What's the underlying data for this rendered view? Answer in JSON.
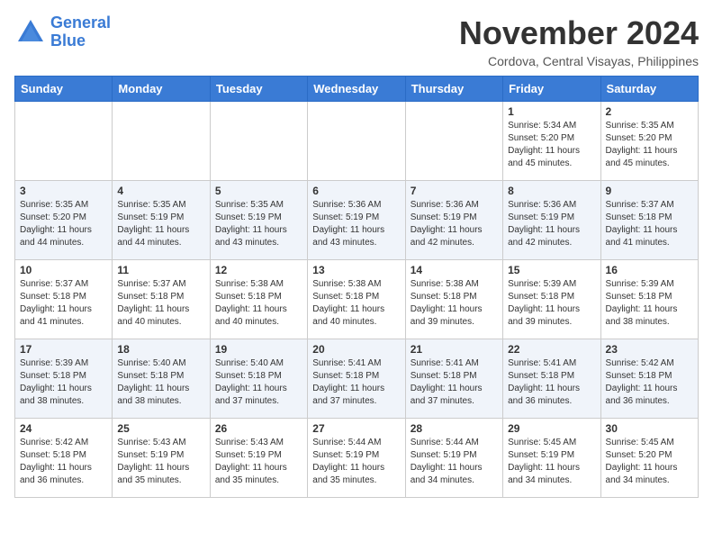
{
  "header": {
    "logo_line1": "General",
    "logo_line2": "Blue",
    "month": "November 2024",
    "location": "Cordova, Central Visayas, Philippines"
  },
  "days_of_week": [
    "Sunday",
    "Monday",
    "Tuesday",
    "Wednesday",
    "Thursday",
    "Friday",
    "Saturday"
  ],
  "weeks": [
    [
      {
        "day": "",
        "sunrise": "",
        "sunset": "",
        "daylight": ""
      },
      {
        "day": "",
        "sunrise": "",
        "sunset": "",
        "daylight": ""
      },
      {
        "day": "",
        "sunrise": "",
        "sunset": "",
        "daylight": ""
      },
      {
        "day": "",
        "sunrise": "",
        "sunset": "",
        "daylight": ""
      },
      {
        "day": "",
        "sunrise": "",
        "sunset": "",
        "daylight": ""
      },
      {
        "day": "1",
        "sunrise": "Sunrise: 5:34 AM",
        "sunset": "Sunset: 5:20 PM",
        "daylight": "Daylight: 11 hours and 45 minutes."
      },
      {
        "day": "2",
        "sunrise": "Sunrise: 5:35 AM",
        "sunset": "Sunset: 5:20 PM",
        "daylight": "Daylight: 11 hours and 45 minutes."
      }
    ],
    [
      {
        "day": "3",
        "sunrise": "Sunrise: 5:35 AM",
        "sunset": "Sunset: 5:20 PM",
        "daylight": "Daylight: 11 hours and 44 minutes."
      },
      {
        "day": "4",
        "sunrise": "Sunrise: 5:35 AM",
        "sunset": "Sunset: 5:19 PM",
        "daylight": "Daylight: 11 hours and 44 minutes."
      },
      {
        "day": "5",
        "sunrise": "Sunrise: 5:35 AM",
        "sunset": "Sunset: 5:19 PM",
        "daylight": "Daylight: 11 hours and 43 minutes."
      },
      {
        "day": "6",
        "sunrise": "Sunrise: 5:36 AM",
        "sunset": "Sunset: 5:19 PM",
        "daylight": "Daylight: 11 hours and 43 minutes."
      },
      {
        "day": "7",
        "sunrise": "Sunrise: 5:36 AM",
        "sunset": "Sunset: 5:19 PM",
        "daylight": "Daylight: 11 hours and 42 minutes."
      },
      {
        "day": "8",
        "sunrise": "Sunrise: 5:36 AM",
        "sunset": "Sunset: 5:19 PM",
        "daylight": "Daylight: 11 hours and 42 minutes."
      },
      {
        "day": "9",
        "sunrise": "Sunrise: 5:37 AM",
        "sunset": "Sunset: 5:18 PM",
        "daylight": "Daylight: 11 hours and 41 minutes."
      }
    ],
    [
      {
        "day": "10",
        "sunrise": "Sunrise: 5:37 AM",
        "sunset": "Sunset: 5:18 PM",
        "daylight": "Daylight: 11 hours and 41 minutes."
      },
      {
        "day": "11",
        "sunrise": "Sunrise: 5:37 AM",
        "sunset": "Sunset: 5:18 PM",
        "daylight": "Daylight: 11 hours and 40 minutes."
      },
      {
        "day": "12",
        "sunrise": "Sunrise: 5:38 AM",
        "sunset": "Sunset: 5:18 PM",
        "daylight": "Daylight: 11 hours and 40 minutes."
      },
      {
        "day": "13",
        "sunrise": "Sunrise: 5:38 AM",
        "sunset": "Sunset: 5:18 PM",
        "daylight": "Daylight: 11 hours and 40 minutes."
      },
      {
        "day": "14",
        "sunrise": "Sunrise: 5:38 AM",
        "sunset": "Sunset: 5:18 PM",
        "daylight": "Daylight: 11 hours and 39 minutes."
      },
      {
        "day": "15",
        "sunrise": "Sunrise: 5:39 AM",
        "sunset": "Sunset: 5:18 PM",
        "daylight": "Daylight: 11 hours and 39 minutes."
      },
      {
        "day": "16",
        "sunrise": "Sunrise: 5:39 AM",
        "sunset": "Sunset: 5:18 PM",
        "daylight": "Daylight: 11 hours and 38 minutes."
      }
    ],
    [
      {
        "day": "17",
        "sunrise": "Sunrise: 5:39 AM",
        "sunset": "Sunset: 5:18 PM",
        "daylight": "Daylight: 11 hours and 38 minutes."
      },
      {
        "day": "18",
        "sunrise": "Sunrise: 5:40 AM",
        "sunset": "Sunset: 5:18 PM",
        "daylight": "Daylight: 11 hours and 38 minutes."
      },
      {
        "day": "19",
        "sunrise": "Sunrise: 5:40 AM",
        "sunset": "Sunset: 5:18 PM",
        "daylight": "Daylight: 11 hours and 37 minutes."
      },
      {
        "day": "20",
        "sunrise": "Sunrise: 5:41 AM",
        "sunset": "Sunset: 5:18 PM",
        "daylight": "Daylight: 11 hours and 37 minutes."
      },
      {
        "day": "21",
        "sunrise": "Sunrise: 5:41 AM",
        "sunset": "Sunset: 5:18 PM",
        "daylight": "Daylight: 11 hours and 37 minutes."
      },
      {
        "day": "22",
        "sunrise": "Sunrise: 5:41 AM",
        "sunset": "Sunset: 5:18 PM",
        "daylight": "Daylight: 11 hours and 36 minutes."
      },
      {
        "day": "23",
        "sunrise": "Sunrise: 5:42 AM",
        "sunset": "Sunset: 5:18 PM",
        "daylight": "Daylight: 11 hours and 36 minutes."
      }
    ],
    [
      {
        "day": "24",
        "sunrise": "Sunrise: 5:42 AM",
        "sunset": "Sunset: 5:18 PM",
        "daylight": "Daylight: 11 hours and 36 minutes."
      },
      {
        "day": "25",
        "sunrise": "Sunrise: 5:43 AM",
        "sunset": "Sunset: 5:19 PM",
        "daylight": "Daylight: 11 hours and 35 minutes."
      },
      {
        "day": "26",
        "sunrise": "Sunrise: 5:43 AM",
        "sunset": "Sunset: 5:19 PM",
        "daylight": "Daylight: 11 hours and 35 minutes."
      },
      {
        "day": "27",
        "sunrise": "Sunrise: 5:44 AM",
        "sunset": "Sunset: 5:19 PM",
        "daylight": "Daylight: 11 hours and 35 minutes."
      },
      {
        "day": "28",
        "sunrise": "Sunrise: 5:44 AM",
        "sunset": "Sunset: 5:19 PM",
        "daylight": "Daylight: 11 hours and 34 minutes."
      },
      {
        "day": "29",
        "sunrise": "Sunrise: 5:45 AM",
        "sunset": "Sunset: 5:19 PM",
        "daylight": "Daylight: 11 hours and 34 minutes."
      },
      {
        "day": "30",
        "sunrise": "Sunrise: 5:45 AM",
        "sunset": "Sunset: 5:20 PM",
        "daylight": "Daylight: 11 hours and 34 minutes."
      }
    ]
  ]
}
